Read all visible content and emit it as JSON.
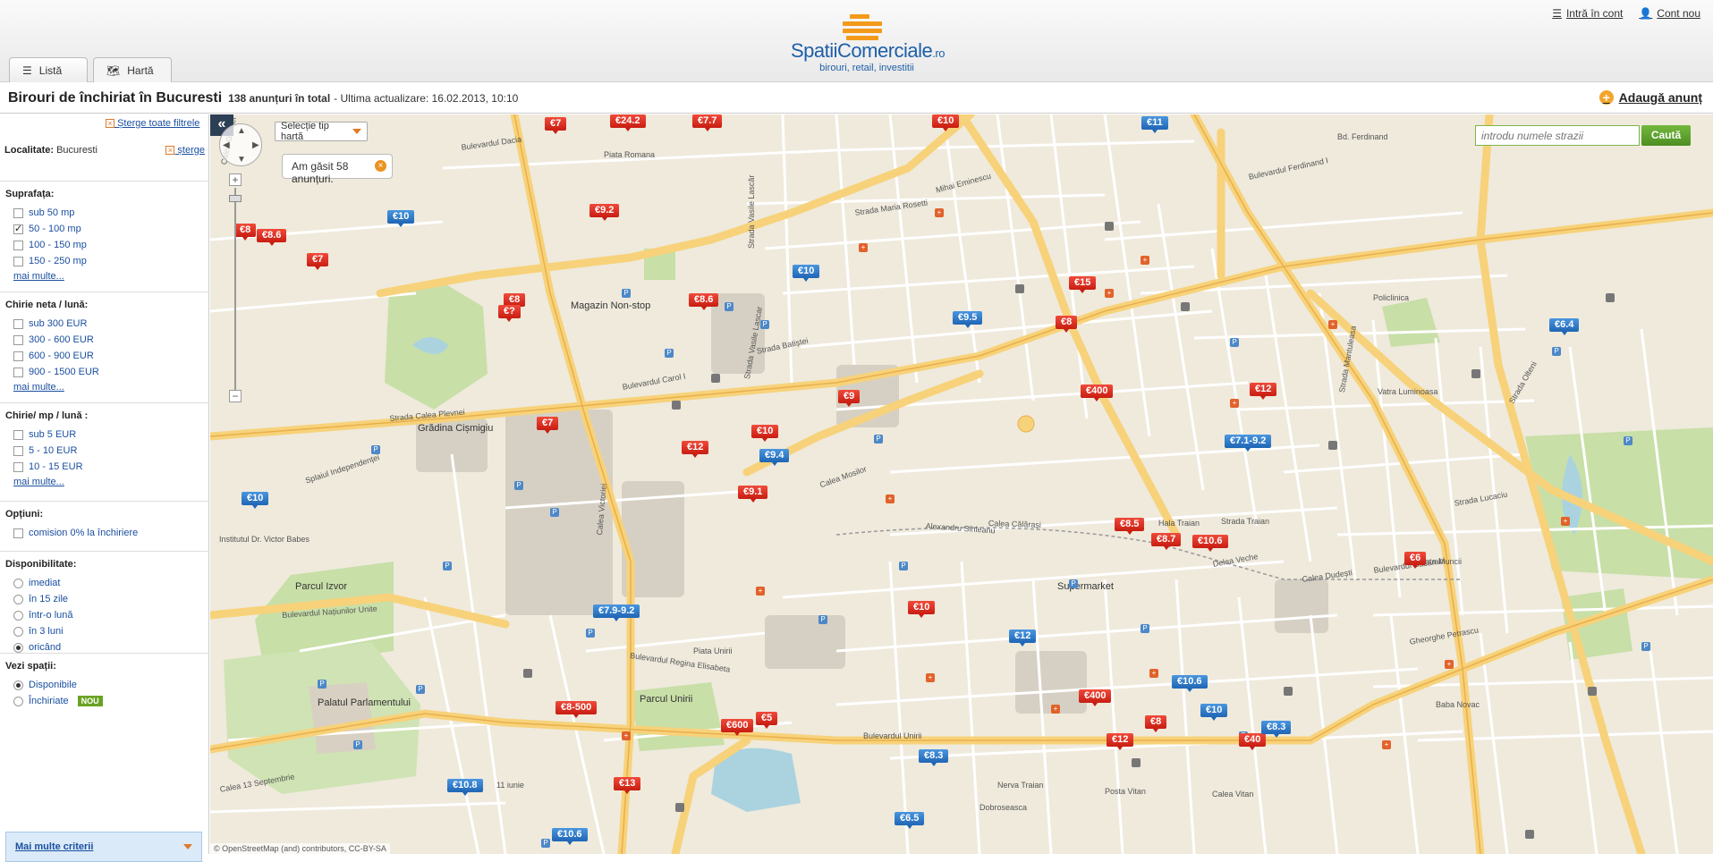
{
  "header": {
    "logo_name_main": "SpatiiComerciale",
    "logo_name_tld": ".ro",
    "logo_tagline": "birouri, retail, investitii",
    "login": "Intră în cont",
    "new_account": "Cont nou"
  },
  "tabs": [
    {
      "label": "Listă",
      "icon": "list-icon"
    },
    {
      "label": "Hartă",
      "icon": "map-icon"
    }
  ],
  "title": {
    "heading": "Birouri de închiriat în Bucuresti",
    "count": "138 anunțuri în total",
    "updated": "- Ultima actualizare: 16.02.2013, 10:10",
    "add_ad": "Adaugă anunț"
  },
  "sidebar": {
    "clear_all": "Șterge toate filtrele",
    "locality_label": "Localitate:",
    "locality_value": "Bucuresti",
    "locality_delete": "șterge",
    "sections": [
      {
        "title": "Suprafața:",
        "type": "checkbox",
        "options": [
          {
            "label": "sub 50 mp",
            "checked": false
          },
          {
            "label": "50 - 100 mp",
            "checked": true
          },
          {
            "label": "100 - 150 mp",
            "checked": false
          },
          {
            "label": "150 - 250 mp",
            "checked": false
          }
        ],
        "more": "mai multe..."
      },
      {
        "title": "Chirie neta / lună:",
        "type": "checkbox",
        "options": [
          {
            "label": "sub 300 EUR",
            "checked": false
          },
          {
            "label": "300 - 600 EUR",
            "checked": false
          },
          {
            "label": "600 - 900 EUR",
            "checked": false
          },
          {
            "label": "900 - 1500 EUR",
            "checked": false
          }
        ],
        "more": "mai multe..."
      },
      {
        "title": "Chirie/ mp / lună :",
        "type": "checkbox",
        "options": [
          {
            "label": "sub 5 EUR",
            "checked": false
          },
          {
            "label": "5 - 10 EUR",
            "checked": false
          },
          {
            "label": "10 - 15 EUR",
            "checked": false
          }
        ],
        "more": "mai multe..."
      },
      {
        "title": "Opțiuni:",
        "type": "checkbox",
        "options": [
          {
            "label": "comision 0% la închiriere",
            "checked": false
          }
        ]
      },
      {
        "title": "Disponibilitate:",
        "type": "radio",
        "options": [
          {
            "label": "imediat",
            "checked": false
          },
          {
            "label": "în 15 zile",
            "checked": false
          },
          {
            "label": "într-o lună",
            "checked": false
          },
          {
            "label": "în 3 luni",
            "checked": false
          },
          {
            "label": "oricând",
            "checked": true
          }
        ]
      },
      {
        "title": "Vezi spații:",
        "type": "radio",
        "options": [
          {
            "label": "Disponibile",
            "checked": true
          },
          {
            "label": "Închiriate",
            "checked": false,
            "badge": "NOU"
          }
        ]
      }
    ],
    "more_criteria": "Mai multe criterii"
  },
  "map": {
    "collapse": "«",
    "map_type": "Selecție tip hartă",
    "found": "Am găsit 58 anunțuri.",
    "search_placeholder": "introdu numele strazii",
    "search_button": "Caută",
    "attribution": "© OpenStreetMap (and) contributors, CC-BY-SA",
    "parks": [
      "Grădina Cișmigiu",
      "Parcul Izvor",
      "Palatul Parlamentului",
      "Parcul Unirii",
      "Magazin Non-stop",
      "Supermarket"
    ],
    "streets": [
      "Calea Griviței",
      "Bulevardul Dacia",
      "Strada Vasile Lascăr",
      "Bulevardul Carol I",
      "Bulevardul Regina Elisabeta",
      "Bulevardul Unirii",
      "Calea Călărași",
      "Bulevardul Basarabi",
      "Strada Maria Rosetti",
      "Bulevardul Națiunilor Unite",
      "Calea 13 Septembrie",
      "Splaiul Independenței",
      "Calea Victoriei",
      "Strada Batiștei",
      "Bulevardul Ferdinand I",
      "Mihai Eminescu",
      "Calea Dudești",
      "Strada Traian",
      "Piata Romana",
      "Piata Unirii",
      "Alexandru Sihleanu",
      "Hala Traian",
      "Delea Veche",
      "Vatra Luminoasa",
      "Bd. Ferdinand",
      "Piata Muncii",
      "Strada Vasile Lascar",
      "Policlinica",
      "Gheorghe Petrascu",
      "Baba Novac",
      "Calea Vitan",
      "Posta Vitan",
      "Dobroseasca",
      "Nerva Traian",
      "Institutul Dr. Victor Babes",
      "11 iunie",
      "Calea Mosilor",
      "Strada Mantuleasa",
      "Strada Olteni",
      "Strada Calea Plevnei",
      "Strada Lucaciu"
    ],
    "markers": [
      {
        "label": "€7",
        "color": "red"
      },
      {
        "label": "€24.2",
        "color": "red"
      },
      {
        "label": "€7.7",
        "color": "red"
      },
      {
        "label": "€10",
        "color": "red"
      },
      {
        "label": "€11",
        "color": "blue"
      },
      {
        "label": "€9.2",
        "color": "red"
      },
      {
        "label": "€10",
        "color": "blue"
      },
      {
        "label": "€8",
        "color": "red"
      },
      {
        "label": "€8.6",
        "color": "red"
      },
      {
        "label": "€7",
        "color": "red"
      },
      {
        "label": "€8",
        "color": "red"
      },
      {
        "label": "€?",
        "color": "red"
      },
      {
        "label": "€8.6",
        "color": "red"
      },
      {
        "label": "€10",
        "color": "blue"
      },
      {
        "label": "€15",
        "color": "red"
      },
      {
        "label": "€9.5",
        "color": "blue"
      },
      {
        "label": "€8",
        "color": "red"
      },
      {
        "label": "€9.1",
        "color": "red"
      },
      {
        "label": "€400",
        "color": "red"
      },
      {
        "label": "€12",
        "color": "red"
      },
      {
        "label": "€7.1-9.2",
        "color": "blue"
      },
      {
        "label": "€9",
        "color": "red"
      },
      {
        "label": "€7",
        "color": "red"
      },
      {
        "label": "€10",
        "color": "red"
      },
      {
        "label": "€12",
        "color": "red"
      },
      {
        "label": "€9.4",
        "color": "blue"
      },
      {
        "label": "€10",
        "color": "blue"
      },
      {
        "label": "€8.5",
        "color": "red"
      },
      {
        "label": "€8.7",
        "color": "red"
      },
      {
        "label": "€10.6",
        "color": "red"
      },
      {
        "label": "€6",
        "color": "red"
      },
      {
        "label": "€6.4",
        "color": "blue"
      },
      {
        "label": "€7.9-9.2",
        "color": "blue"
      },
      {
        "label": "€10",
        "color": "red"
      },
      {
        "label": "€12",
        "color": "blue"
      },
      {
        "label": "€10.6",
        "color": "blue"
      },
      {
        "label": "€400",
        "color": "red"
      },
      {
        "label": "€10",
        "color": "blue"
      },
      {
        "label": "€8",
        "color": "red"
      },
      {
        "label": "€12",
        "color": "red"
      },
      {
        "label": "€40",
        "color": "red"
      },
      {
        "label": "€8.3",
        "color": "blue"
      },
      {
        "label": "€8-500",
        "color": "red"
      },
      {
        "label": "€600",
        "color": "red"
      },
      {
        "label": "€5",
        "color": "red"
      },
      {
        "label": "€8.3",
        "color": "blue"
      },
      {
        "label": "€10.8",
        "color": "blue"
      },
      {
        "label": "€13",
        "color": "red"
      },
      {
        "label": "€10.6",
        "color": "blue"
      },
      {
        "label": "€6.5",
        "color": "blue"
      }
    ]
  }
}
